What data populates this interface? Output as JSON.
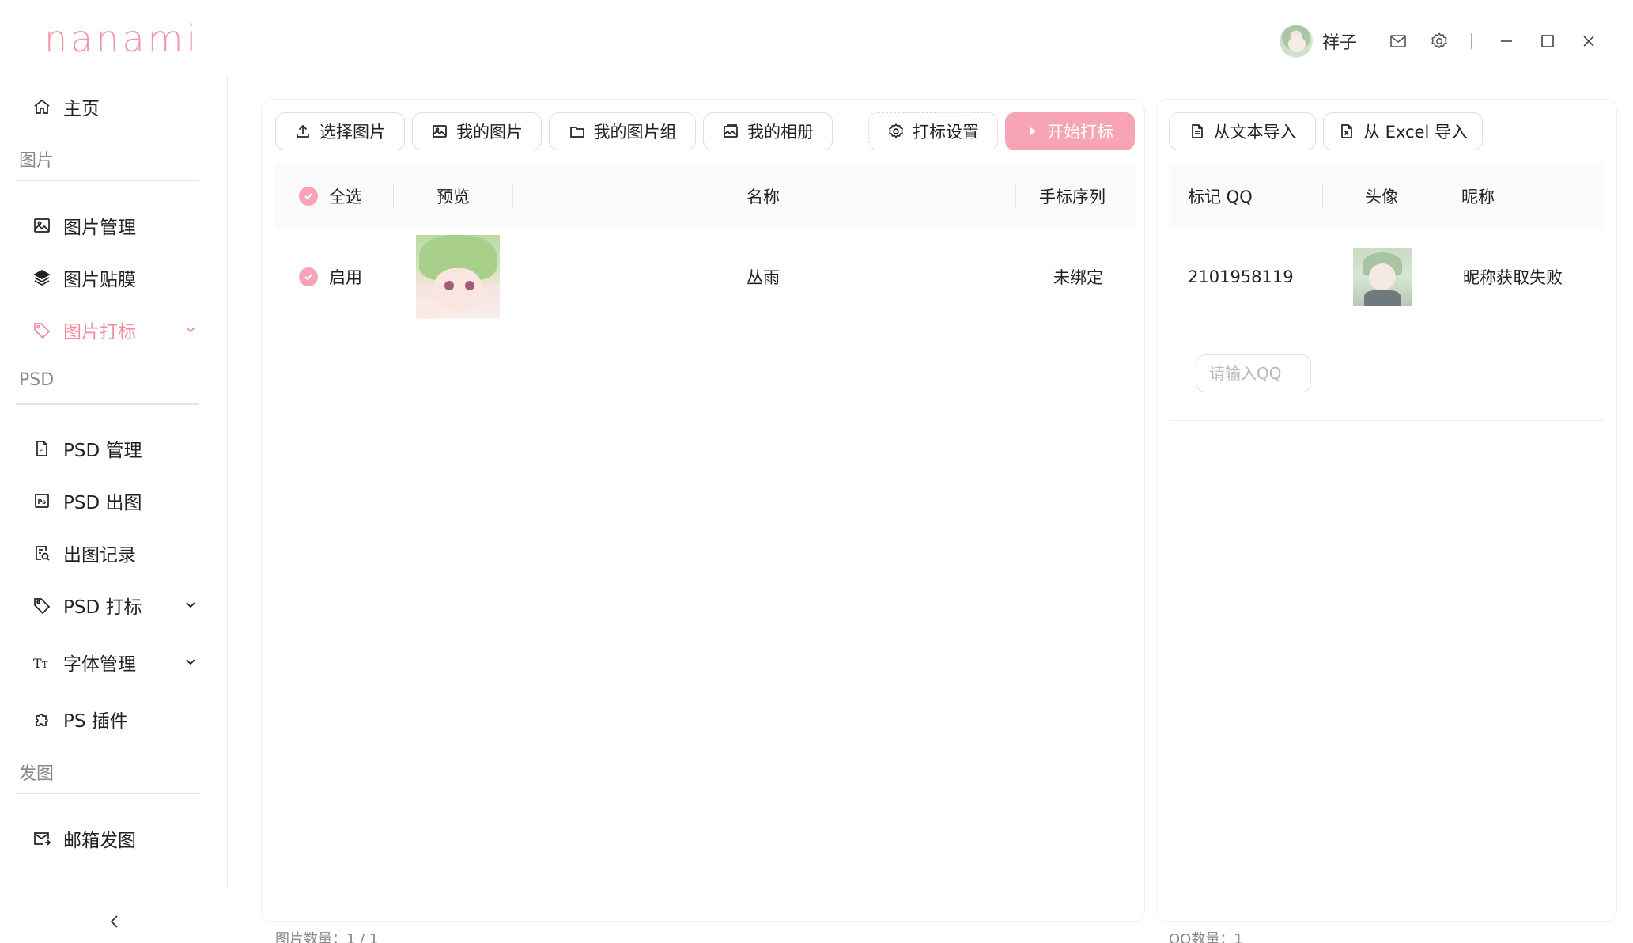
{
  "app": {
    "logo": "nanami"
  },
  "titlebar": {
    "username": "祥子"
  },
  "sidebar": {
    "home": "主页",
    "section_image": "图片",
    "image_manage": "图片管理",
    "image_film": "图片贴膜",
    "image_mark": "图片打标",
    "section_psd": "PSD",
    "psd_manage": "PSD 管理",
    "psd_output": "PSD 出图",
    "output_record": "出图记录",
    "psd_mark": "PSD 打标",
    "font_manage": "字体管理",
    "ps_plugin": "PS 插件",
    "section_send": "发图",
    "mail_send": "邮箱发图",
    "accent_color": "#f28da2"
  },
  "left_panel": {
    "buttons": {
      "select_images": "选择图片",
      "my_images": "我的图片",
      "my_image_groups": "我的图片组",
      "my_albums": "我的相册",
      "mark_settings": "打标设置",
      "start_marking": "开始打标"
    },
    "columns": {
      "select_all": "全选",
      "preview": "预览",
      "name": "名称",
      "hand_sequence": "手标序列"
    },
    "rows": [
      {
        "enabled_label": "启用",
        "name": "丛雨",
        "hand_sequence": "未绑定"
      }
    ],
    "footer": "图片数量：1 / 1"
  },
  "right_panel": {
    "buttons": {
      "import_text": "从文本导入",
      "import_excel": "从 Excel 导入"
    },
    "columns": {
      "mark_qq": "标记 QQ",
      "avatar": "头像",
      "nickname": "昵称"
    },
    "rows": [
      {
        "qq": "2101958119",
        "nickname": "昵称获取失败"
      }
    ],
    "qq_input_placeholder": "请输入QQ",
    "footer": "QQ数量：1"
  }
}
